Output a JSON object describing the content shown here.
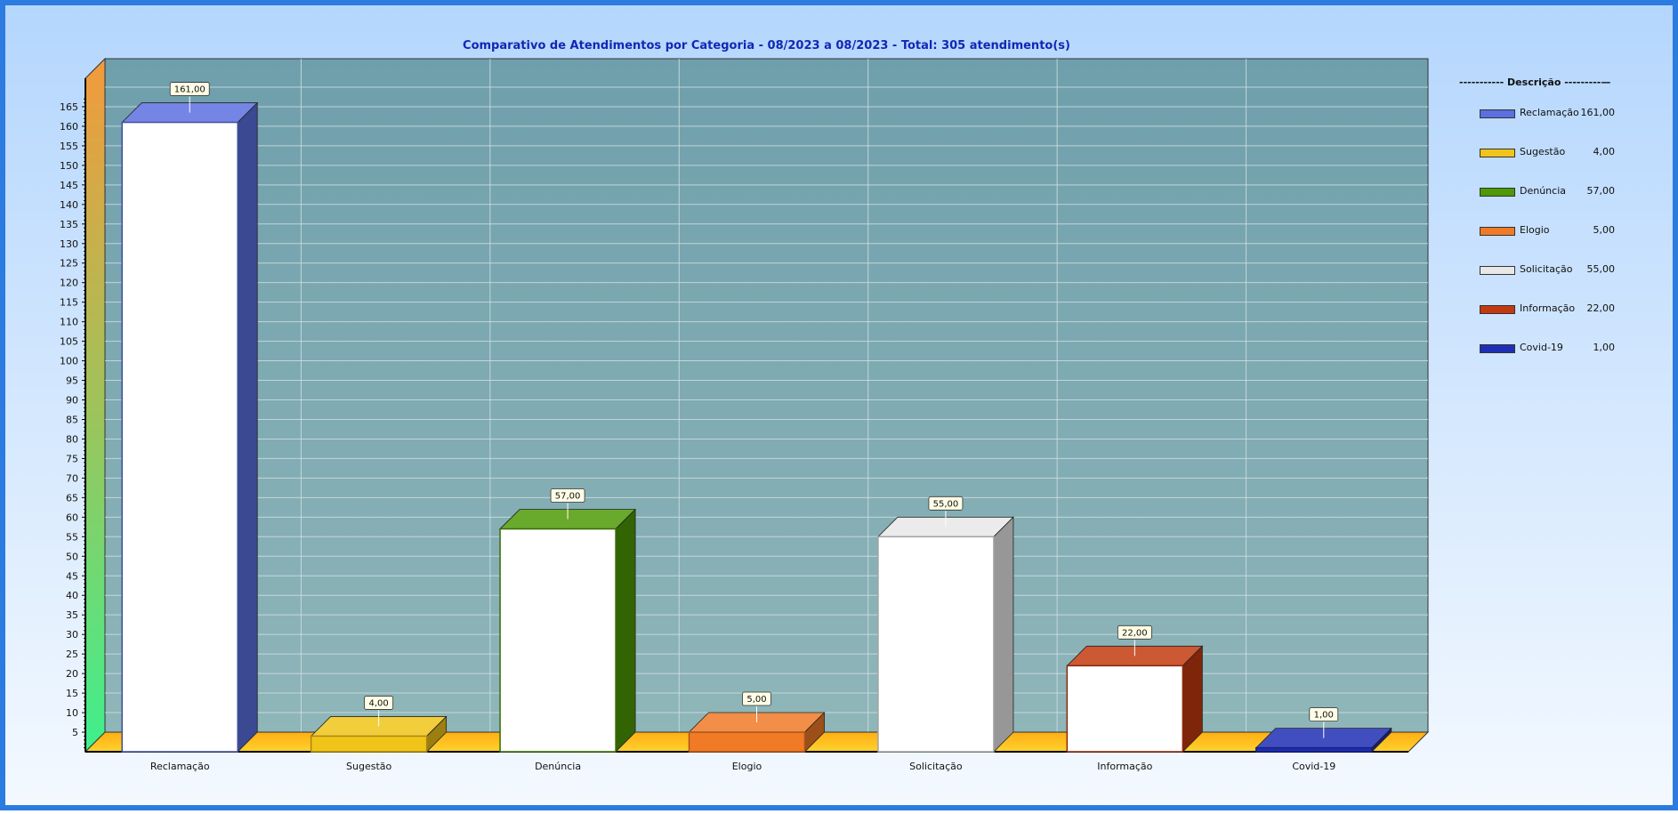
{
  "chart_data": {
    "type": "bar",
    "title": "Comparativo  de  Atendimentos  por  Categoria  -  08/2023  a  08/2023  -  Total:  305  atendimento(s)",
    "categories": [
      "Reclamação",
      "Sugestão",
      "Denúncia",
      "Elogio",
      "Solicitação",
      "Informação",
      "Covid-19"
    ],
    "values": [
      161,
      4,
      57,
      5,
      55,
      22,
      1
    ],
    "value_labels": [
      "161,00",
      "4,00",
      "57,00",
      "5,00",
      "55,00",
      "22,00",
      "1,00"
    ],
    "y_ticks": [
      5,
      10,
      15,
      20,
      25,
      30,
      35,
      40,
      45,
      50,
      55,
      60,
      65,
      70,
      75,
      80,
      85,
      90,
      95,
      100,
      105,
      110,
      115,
      120,
      125,
      130,
      135,
      140,
      145,
      150,
      155,
      160,
      165
    ],
    "ylim": [
      0,
      165
    ],
    "grid": true,
    "legend_position": "right",
    "colors": [
      "#5b6fe0",
      "#f0c419",
      "#4e9a06",
      "#f07a26",
      "#e8e8e8",
      "#c43a10",
      "#1f2fb5"
    ],
    "legend": {
      "title": "----------- Descrição ---------—",
      "labels": [
        "Reclamação",
        "Sugestão",
        "Denúncia",
        "Elogio",
        "Solicitação",
        "Informação",
        "Covid-19"
      ],
      "values": [
        "161,00",
        "4,00",
        "57,00",
        "5,00",
        "55,00",
        "22,00",
        "1,00"
      ]
    }
  }
}
